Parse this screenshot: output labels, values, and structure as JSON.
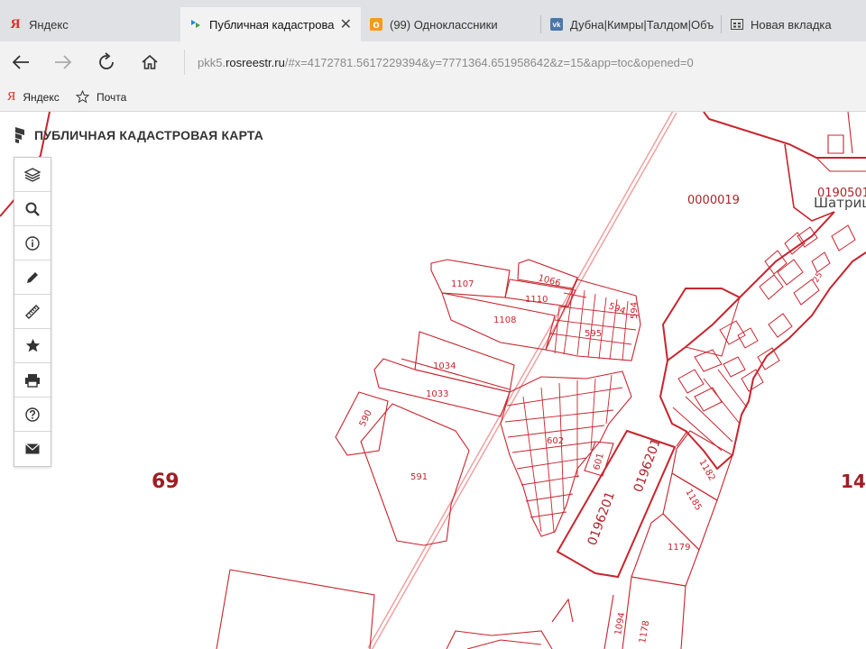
{
  "tabs": [
    {
      "title": "Яндекс",
      "icon": "yandex-icon",
      "active": false
    },
    {
      "title": "Публичная кадастрова",
      "icon": "rosreestr-icon",
      "active": true
    },
    {
      "title": "(99) Одноклассники",
      "icon": "odnoklassniki-icon",
      "active": false
    },
    {
      "title": "Дубна|Кимры|Талдом|Объ",
      "icon": "vk-icon",
      "active": false
    },
    {
      "title": "Новая вкладка",
      "icon": "new-tab-icon",
      "active": false
    }
  ],
  "address": {
    "domain_prefix": "pkk5.",
    "domain": "rosreestr.ru",
    "path": "/#x=4172781.5617229394&y=7771364.651958642&z=15&app=toc&opened=0"
  },
  "favorites": [
    {
      "label": "Яндекс",
      "icon": "yandex-icon"
    },
    {
      "label": "Почта",
      "icon": "star-icon"
    }
  ],
  "map": {
    "title": "ПУБЛИЧНАЯ КАДАСТРОВАЯ КАРТА",
    "tools": [
      "layers-icon",
      "search-icon",
      "info-icon",
      "pencil-icon",
      "ruler-icon",
      "star-icon",
      "print-icon",
      "help-icon",
      "mail-icon"
    ],
    "district_labels": [
      "69",
      "14"
    ],
    "quarter_labels": [
      "0000019",
      "0190501",
      "0196201",
      "0196201"
    ],
    "settlement_label": "Шатрищ",
    "parcel_labels": [
      "1107",
      "1066",
      "1110",
      "1108",
      "594",
      "594",
      "595",
      "1034",
      "1033",
      "590",
      "591",
      "602",
      "601",
      "1182",
      "1185",
      "1179",
      "1094",
      "1178",
      "25"
    ]
  },
  "colors": {
    "parcel": "#c8242e",
    "road": "#f0a0a0",
    "accent": "#2b8a3e"
  }
}
